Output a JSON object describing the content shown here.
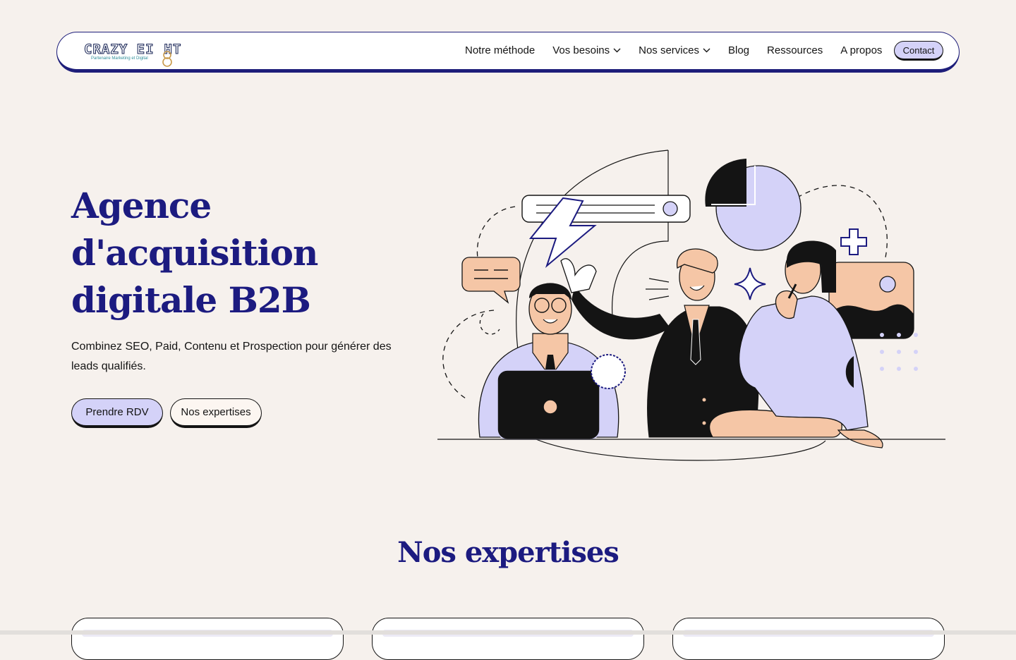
{
  "logo": {
    "brand": "CRAZY EI",
    "brand_end": "HT",
    "tagline": "Partenaire Marketing et Digital"
  },
  "nav": {
    "items": [
      {
        "label": "Notre méthode",
        "has_dropdown": false
      },
      {
        "label": "Vos besoins",
        "has_dropdown": true
      },
      {
        "label": "Nos services",
        "has_dropdown": true
      },
      {
        "label": "Blog",
        "has_dropdown": false
      },
      {
        "label": "Ressources",
        "has_dropdown": false
      },
      {
        "label": "A propos",
        "has_dropdown": false
      }
    ],
    "contact_label": "Contact"
  },
  "hero": {
    "title_line1": "Agence",
    "title_line2": "d'acquisition",
    "title_line3": "digitale B2B",
    "subtitle": "Combinez SEO, Paid, Contenu et Prospection pour générer des leads qualifiés.",
    "primary_cta": "Prendre RDV",
    "secondary_cta": "Nos expertises"
  },
  "expertises": {
    "title": "Nos expertises"
  },
  "colors": {
    "background": "#f6f1ed",
    "brand_navy": "#1c1b80",
    "lavender": "#d4d2f8",
    "peach": "#f5c6a6",
    "ink": "#141414"
  }
}
